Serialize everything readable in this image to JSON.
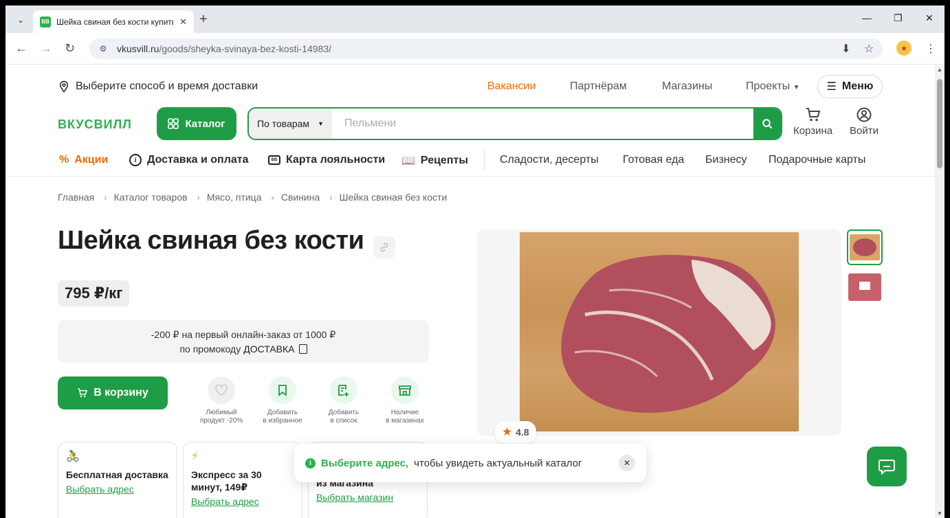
{
  "browser": {
    "tab_title": "Шейка свиная без кости купить",
    "favicon_text": "ВВ",
    "url_domain": "vkusvill.ru",
    "url_path": "/goods/sheyka-svinaya-bez-kosti-14983/"
  },
  "topnav": {
    "delivery_choice": "Выберите способ и время доставки",
    "links": [
      "Вакансии",
      "Партнёрам",
      "Магазины",
      "Проекты"
    ],
    "menu_label": "Меню"
  },
  "header": {
    "logo": "ВКУСВИЛЛ",
    "catalog_label": "Каталог",
    "search_scope": "По товарам",
    "search_placeholder": "Пельмени",
    "cart_label": "Корзина",
    "login_label": "Войти"
  },
  "subnav": {
    "promo": "Акции",
    "delivery": "Доставка и оплата",
    "loyalty": "Карта лояльности",
    "recipes": "Рецепты",
    "plain": [
      "Сладости, десерты",
      "Готовая еда",
      "Бизнесу",
      "Подарочные карты"
    ]
  },
  "breadcrumb": [
    "Главная",
    "Каталог товаров",
    "Мясо, птица",
    "Свинина",
    "Шейка свиная без кости"
  ],
  "product": {
    "title": "Шейка свиная без кости",
    "price": "795 ₽/кг",
    "promo_line1": "-200 ₽ на первый онлайн-заказ от 1000 ₽",
    "promo_line2": "по промокоду",
    "promo_code": "ДОСТАВКА",
    "cart_button": "В корзину",
    "rating": "4.8"
  },
  "actions": [
    {
      "line1": "Любимый",
      "line2": "продукт -20%"
    },
    {
      "line1": "Добавить",
      "line2": "в избранное"
    },
    {
      "line1": "Добавить",
      "line2": "в список"
    },
    {
      "line1": "Наличие",
      "line2": "в магазинах"
    }
  ],
  "delivery_cards": [
    {
      "title": "Бесплатная доставка",
      "link": "Выбрать адрес"
    },
    {
      "title": "Экспресс за 30 минут, 149₽",
      "link": "Выбрать адрес"
    },
    {
      "title": "из магазина",
      "link": "Выбрать магазин"
    }
  ],
  "toast": {
    "strong": "Выберите адрес,",
    "rest": "чтобы увидеть актуальный каталог"
  },
  "colors": {
    "brand_green": "#1f9d46",
    "accent_orange": "#f06800"
  }
}
